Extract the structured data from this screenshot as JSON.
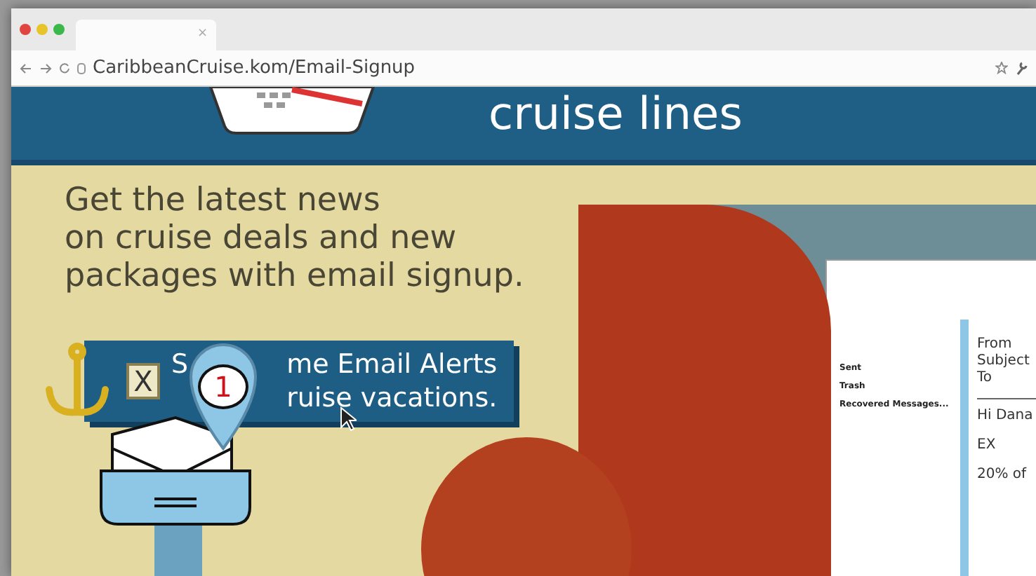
{
  "browser": {
    "tab_close": "×",
    "address": "CaribbeanCruise.kom/Email-Signup"
  },
  "banner": {
    "title": "cruise lines"
  },
  "headline_lines": [
    "Get the latest news",
    "on cruise deals and new",
    "packages with email signup."
  ],
  "signup": {
    "checkbox_mark": "X",
    "checked": true,
    "first_letter": "S",
    "lines": [
      "me Email Alerts",
      "ruise vacations."
    ]
  },
  "inbox_badge": "1",
  "email_client": {
    "folders": [
      "Sent",
      "Trash",
      "Recovered Messages..."
    ],
    "header_labels": [
      "From",
      "Subject",
      "To"
    ],
    "greeting": "Hi Dana",
    "body_lines": [
      "EX",
      "20% of"
    ]
  }
}
